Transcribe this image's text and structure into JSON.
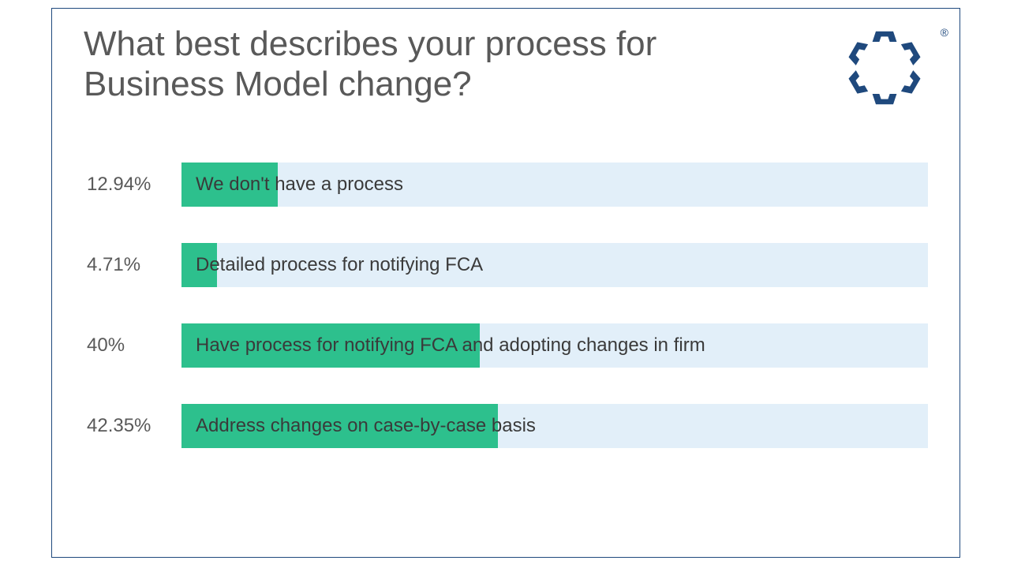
{
  "title": "What best describes your process for Business Model change?",
  "logo_mark": "®",
  "chart_data": {
    "type": "bar",
    "orientation": "horizontal",
    "title": "What best describes your process for Business Model change?",
    "xlabel": "",
    "ylabel": "",
    "xlim": [
      0,
      100
    ],
    "categories": [
      "We don't have a process",
      "Detailed process for notifying FCA",
      "Have process for notifying FCA and adopting changes in firm",
      "Address changes on case-by-case basis"
    ],
    "values": [
      12.94,
      4.71,
      40,
      42.35
    ],
    "value_labels": [
      "12.94%",
      "4.71%",
      "40%",
      "42.35%"
    ],
    "colors": {
      "fill": "#2dc08d",
      "track": "#e2eff9"
    }
  }
}
